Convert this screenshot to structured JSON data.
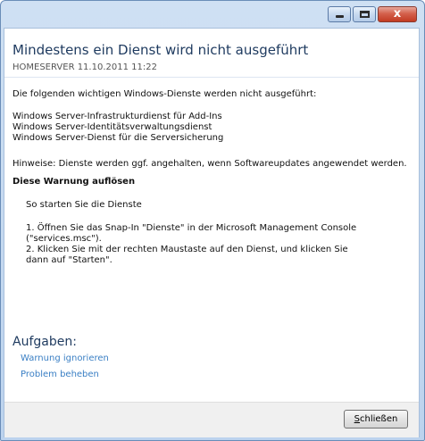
{
  "window": {
    "caption_buttons": {
      "minimize_icon": "minimize-icon",
      "maximize_icon": "maximize-icon",
      "close_icon": "close-icon",
      "close_glyph": "x"
    }
  },
  "alert": {
    "title": "Mindestens ein Dienst wird nicht ausgeführt",
    "meta": "HOMESERVER 11.10.2011 11:22",
    "intro": "Die folgenden wichtigen Windows-Dienste werden nicht ausgeführt:",
    "services": [
      "Windows Server-Infrastrukturdienst für Add-Ins",
      "Windows Server-Identitätsverwaltungsdienst",
      "Windows Server-Dienst für die Serversicherung"
    ],
    "hint": "Hinweise: Dienste werden ggf. angehalten, wenn Softwareupdates angewendet werden.",
    "resolve_heading": "Diese Warnung auflösen",
    "resolve_intro": "So starten Sie die Dienste",
    "steps": [
      "1. Öffnen Sie das Snap-In \"Dienste\" in der Microsoft Management Console",
      "(\"services.msc\").",
      "2. Klicken Sie mit der rechten Maustaste auf den Dienst, und klicken Sie",
      "dann auf \"Starten\"."
    ]
  },
  "tasks": {
    "heading": "Aufgaben:",
    "links": [
      "Warnung ignorieren",
      "Problem beheben"
    ]
  },
  "footer": {
    "close_mnemonic": "S",
    "close_rest": "chließen"
  }
}
